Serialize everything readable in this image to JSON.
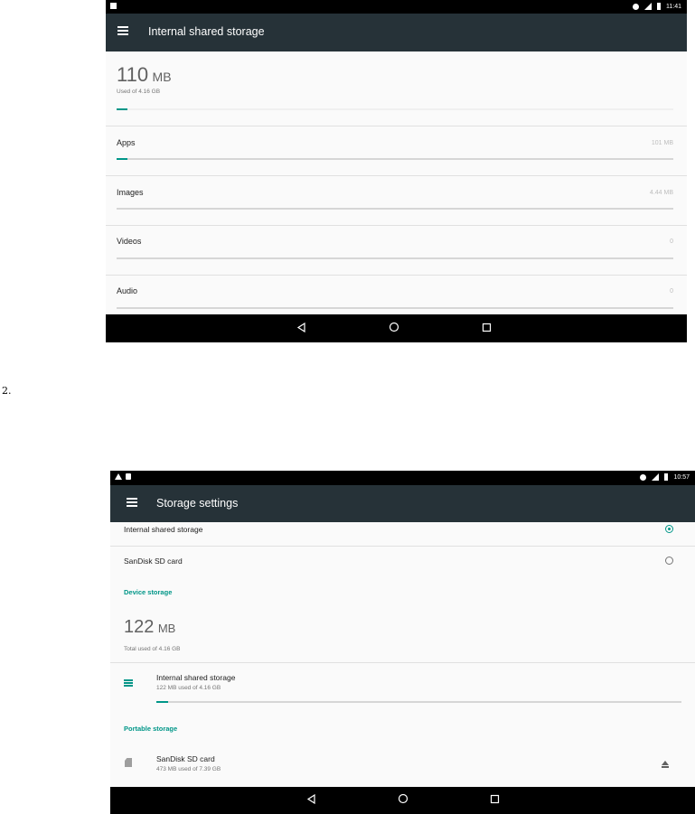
{
  "screen1": {
    "status_time": "11:41",
    "title": "Internal shared storage",
    "used_amount": "110",
    "used_unit": "MB",
    "used_caption": "Used of 4.16 GB",
    "used_fraction": 0.026,
    "categories": [
      {
        "label": "Apps",
        "value": "101 MB",
        "fraction": 0.024
      },
      {
        "label": "Images",
        "value": "4.44 MB",
        "fraction": 0.0
      },
      {
        "label": "Videos",
        "value": "0",
        "fraction": 0.0
      },
      {
        "label": "Audio",
        "value": "0",
        "fraction": 0.0
      }
    ]
  },
  "page_note": "2.",
  "screen2": {
    "status_time": "10:57",
    "title": "Storage settings",
    "options": [
      {
        "label": "Internal shared storage",
        "selected": true
      },
      {
        "label": "SanDisk SD card",
        "selected": false
      }
    ],
    "device_section": "Device storage",
    "total_amount": "122",
    "total_unit": "MB",
    "total_caption": "Total used of 4.16 GB",
    "internal": {
      "title": "Internal shared storage",
      "caption": "122 MB used of 4.16 GB",
      "fraction": 0.029
    },
    "portable_section": "Portable storage",
    "sdcard": {
      "title": "SanDisk SD card",
      "caption": "473 MB used of 7.39 GB"
    }
  },
  "colors": {
    "accent": "#009688",
    "toolbar": "#263238",
    "statusbar": "#000000"
  },
  "icons": [
    "menu-icon",
    "back-icon",
    "home-icon",
    "recents-icon",
    "storage-list-icon",
    "sd-card-icon",
    "eject-icon",
    "signal-icon",
    "battery-icon",
    "do-not-disturb-icon"
  ]
}
